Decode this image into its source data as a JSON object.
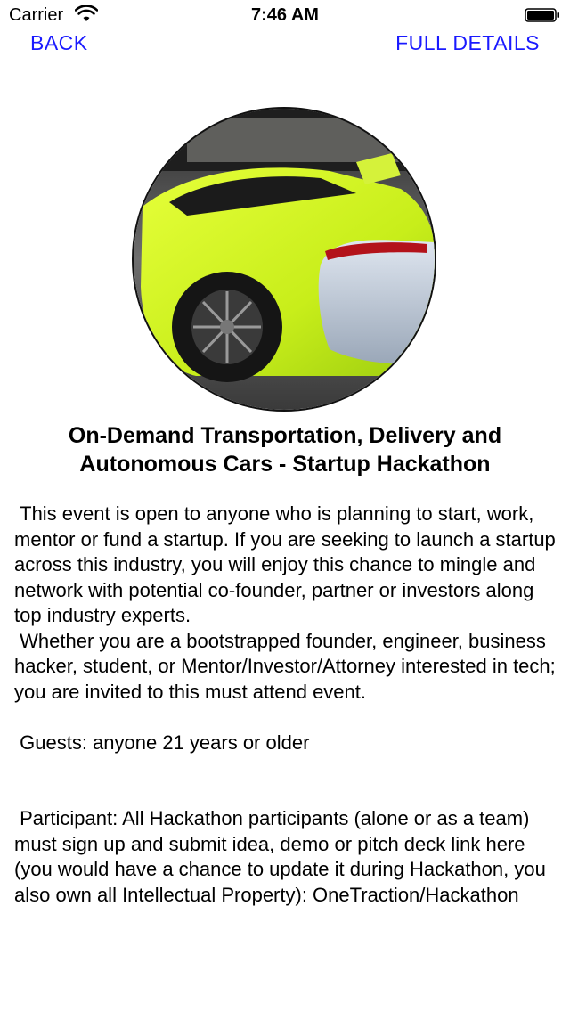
{
  "status_bar": {
    "carrier": "Carrier",
    "time": "7:46 AM",
    "icons": [
      "wifi-icon",
      "battery-icon"
    ]
  },
  "nav": {
    "back_label": "BACK",
    "full_details_label": "FULL DETAILS",
    "accent_color": "#1a1aff"
  },
  "event": {
    "image_subject": "lime-green sports car rear view",
    "title": "On-Demand Transportation, Delivery and Autonomous Cars - Startup Hackathon",
    "description": " This event is open to anyone who is planning to start, work, mentor or fund a startup. If you are seeking to launch a startup across this industry, you will enjoy this chance to mingle and network with potential co-founder, partner or investors along top industry experts.\n Whether you are a bootstrapped founder, engineer, business hacker, student, or Mentor/Investor/Attorney interested in tech; you are invited to this must attend event.\n\n Guests: anyone 21 years or older\n\n\n Participant: All Hackathon participants (alone or as a team) must sign up and submit idea, demo or pitch deck link here (you would have a chance to update it during Hackathon, you also own all Intellectual Property): OneTraction/Hackathon"
  }
}
